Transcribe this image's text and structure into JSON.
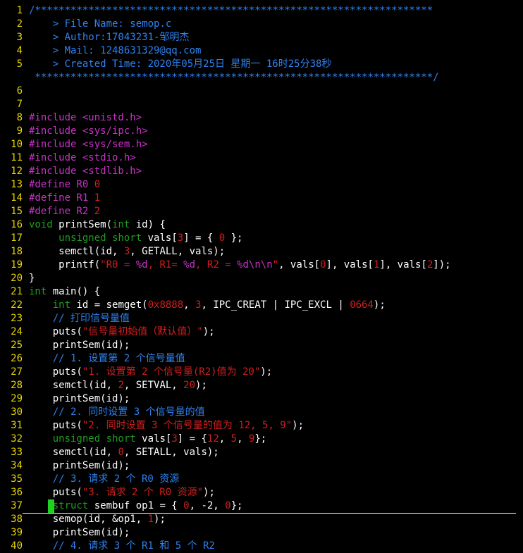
{
  "colors": {
    "background": "#000000",
    "line_number": "#e6d400",
    "plain": "#ffffff",
    "comment": "#2e82f0",
    "preproc": "#c832c8",
    "header": "#c832c8",
    "string": "#d21e1e",
    "keyword": "#1e9e1e",
    "number": "#d21e1e",
    "cursor": "#1ed21e"
  },
  "editor": {
    "cursor_line": 37,
    "lines": [
      {
        "n": "1",
        "t": [
          [
            "cm",
            "/*******************************************************************"
          ]
        ]
      },
      {
        "n": "2",
        "t": [
          [
            "cm",
            "    > File Name: semop.c"
          ]
        ]
      },
      {
        "n": "3",
        "t": [
          [
            "cm",
            "    > Author:17043231-邹明杰"
          ]
        ]
      },
      {
        "n": "4",
        "t": [
          [
            "cm",
            "    > Mail: 1248631329@qq.com"
          ]
        ]
      },
      {
        "n": "5",
        "t": [
          [
            "cm",
            "    > Created Time: 2020年05月25日 星期一 16时25分38秒"
          ]
        ]
      },
      {
        "n": "",
        "t": [
          [
            "cm",
            " *******************************************************************/"
          ]
        ]
      },
      {
        "n": "6",
        "t": []
      },
      {
        "n": "7",
        "t": []
      },
      {
        "n": "8",
        "t": [
          [
            "pp",
            "#include "
          ],
          [
            "pp",
            "<unistd.h>"
          ]
        ]
      },
      {
        "n": "9",
        "t": [
          [
            "pp",
            "#include "
          ],
          [
            "pp",
            "<sys/ipc.h>"
          ]
        ]
      },
      {
        "n": "10",
        "t": [
          [
            "pp",
            "#include "
          ],
          [
            "pp",
            "<sys/sem.h>"
          ]
        ]
      },
      {
        "n": "11",
        "t": [
          [
            "pp",
            "#include "
          ],
          [
            "pp",
            "<stdio.h>"
          ]
        ]
      },
      {
        "n": "12",
        "t": [
          [
            "pp",
            "#include "
          ],
          [
            "pp",
            "<stdlib.h>"
          ]
        ]
      },
      {
        "n": "13",
        "t": [
          [
            "pp",
            "#define R0 "
          ],
          [
            "nm",
            "0"
          ]
        ]
      },
      {
        "n": "14",
        "t": [
          [
            "pp",
            "#define R1 "
          ],
          [
            "nm",
            "1"
          ]
        ]
      },
      {
        "n": "15",
        "t": [
          [
            "pp",
            "#define R2 "
          ],
          [
            "nm",
            "2"
          ]
        ]
      },
      {
        "n": "16",
        "t": [
          [
            "kw",
            "void"
          ],
          [
            "pl",
            " printSem("
          ],
          [
            "kw",
            "int"
          ],
          [
            "pl",
            " id) {"
          ]
        ]
      },
      {
        "n": "17",
        "t": [
          [
            "pl",
            "     "
          ],
          [
            "kw",
            "unsigned short"
          ],
          [
            "pl",
            " vals["
          ],
          [
            "nm",
            "3"
          ],
          [
            "pl",
            "] = { "
          ],
          [
            "nm",
            "0"
          ],
          [
            "pl",
            " };"
          ]
        ]
      },
      {
        "n": "18",
        "t": [
          [
            "pl",
            "     semctl(id, "
          ],
          [
            "nm",
            "3"
          ],
          [
            "pl",
            ", GETALL, vals);"
          ]
        ]
      },
      {
        "n": "19",
        "t": [
          [
            "pl",
            "     printf("
          ],
          [
            "str",
            "\"R0 = "
          ],
          [
            "pp",
            "%d"
          ],
          [
            "str",
            ", R1= "
          ],
          [
            "pp",
            "%d"
          ],
          [
            "str",
            ", R2 = "
          ],
          [
            "pp",
            "%d\\n\\n"
          ],
          [
            "str",
            "\""
          ],
          [
            "pl",
            ", vals["
          ],
          [
            "nm",
            "0"
          ],
          [
            "pl",
            "], vals["
          ],
          [
            "nm",
            "1"
          ],
          [
            "pl",
            "], vals["
          ],
          [
            "nm",
            "2"
          ],
          [
            "pl",
            "]);"
          ]
        ]
      },
      {
        "n": "20",
        "t": [
          [
            "pl",
            "}"
          ]
        ]
      },
      {
        "n": "21",
        "t": [
          [
            "kw",
            "int"
          ],
          [
            "pl",
            " main() {"
          ]
        ]
      },
      {
        "n": "22",
        "t": [
          [
            "pl",
            "    "
          ],
          [
            "kw",
            "int"
          ],
          [
            "pl",
            " id = semget("
          ],
          [
            "nm",
            "0x8888"
          ],
          [
            "pl",
            ", "
          ],
          [
            "nm",
            "3"
          ],
          [
            "pl",
            ", IPC_CREAT | IPC_EXCL | "
          ],
          [
            "nm",
            "0664"
          ],
          [
            "pl",
            ");"
          ]
        ]
      },
      {
        "n": "23",
        "t": [
          [
            "pl",
            "    "
          ],
          [
            "cm",
            "// 打印信号量值"
          ]
        ]
      },
      {
        "n": "24",
        "t": [
          [
            "pl",
            "    puts("
          ],
          [
            "str",
            "\"信号量初始值（默认值）\""
          ],
          [
            "pl",
            ");"
          ]
        ]
      },
      {
        "n": "25",
        "t": [
          [
            "pl",
            "    printSem(id);"
          ]
        ]
      },
      {
        "n": "26",
        "t": [
          [
            "pl",
            "    "
          ],
          [
            "cm",
            "// 1. 设置第 2 个信号量值"
          ]
        ]
      },
      {
        "n": "27",
        "t": [
          [
            "pl",
            "    puts("
          ],
          [
            "str",
            "\"1. 设置第 2 个信号量(R2)值为 20\""
          ],
          [
            "pl",
            ");"
          ]
        ]
      },
      {
        "n": "28",
        "t": [
          [
            "pl",
            "    semctl(id, "
          ],
          [
            "nm",
            "2"
          ],
          [
            "pl",
            ", SETVAL, "
          ],
          [
            "nm",
            "20"
          ],
          [
            "pl",
            ");"
          ]
        ]
      },
      {
        "n": "29",
        "t": [
          [
            "pl",
            "    printSem(id);"
          ]
        ]
      },
      {
        "n": "30",
        "t": [
          [
            "pl",
            "    "
          ],
          [
            "cm",
            "// 2. 同时设置 3 个信号量的值"
          ]
        ]
      },
      {
        "n": "31",
        "t": [
          [
            "pl",
            "    puts("
          ],
          [
            "str",
            "\"2. 同时设置 3 个信号量的值为 12, 5, 9\""
          ],
          [
            "pl",
            ");"
          ]
        ]
      },
      {
        "n": "32",
        "t": [
          [
            "pl",
            "    "
          ],
          [
            "kw",
            "unsigned short"
          ],
          [
            "pl",
            " vals["
          ],
          [
            "nm",
            "3"
          ],
          [
            "pl",
            "] = {"
          ],
          [
            "nm",
            "12"
          ],
          [
            "pl",
            ", "
          ],
          [
            "nm",
            "5"
          ],
          [
            "pl",
            ", "
          ],
          [
            "nm",
            "9"
          ],
          [
            "pl",
            "};"
          ]
        ]
      },
      {
        "n": "33",
        "t": [
          [
            "pl",
            "    semctl(id, "
          ],
          [
            "nm",
            "0"
          ],
          [
            "pl",
            ", SETALL, vals);"
          ]
        ]
      },
      {
        "n": "34",
        "t": [
          [
            "pl",
            "    printSem(id);"
          ]
        ]
      },
      {
        "n": "35",
        "t": [
          [
            "pl",
            "    "
          ],
          [
            "cm",
            "// 3. 请求 2 个 R0 资源"
          ]
        ]
      },
      {
        "n": "36",
        "t": [
          [
            "pl",
            "    puts("
          ],
          [
            "str",
            "\"3. 请求 2 个 R0 资源\""
          ],
          [
            "pl",
            ");"
          ]
        ]
      },
      {
        "n": "37",
        "t": [
          [
            "pl",
            "    "
          ],
          [
            "kw",
            "struct"
          ],
          [
            "pl",
            " sembuf op1 = { "
          ],
          [
            "nm",
            "0"
          ],
          [
            "pl",
            ", -2, "
          ],
          [
            "nm",
            "0"
          ],
          [
            "pl",
            "};"
          ]
        ]
      },
      {
        "n": "38",
        "t": [
          [
            "pl",
            "    semop(id, &op1, "
          ],
          [
            "nm",
            "1"
          ],
          [
            "pl",
            ");"
          ]
        ]
      },
      {
        "n": "39",
        "t": [
          [
            "pl",
            "    printSem(id);"
          ]
        ]
      },
      {
        "n": "40",
        "t": [
          [
            "pl",
            "    "
          ],
          [
            "cm",
            "// 4. 请求 3 个 R1 和 5 个 R2"
          ]
        ]
      }
    ]
  }
}
